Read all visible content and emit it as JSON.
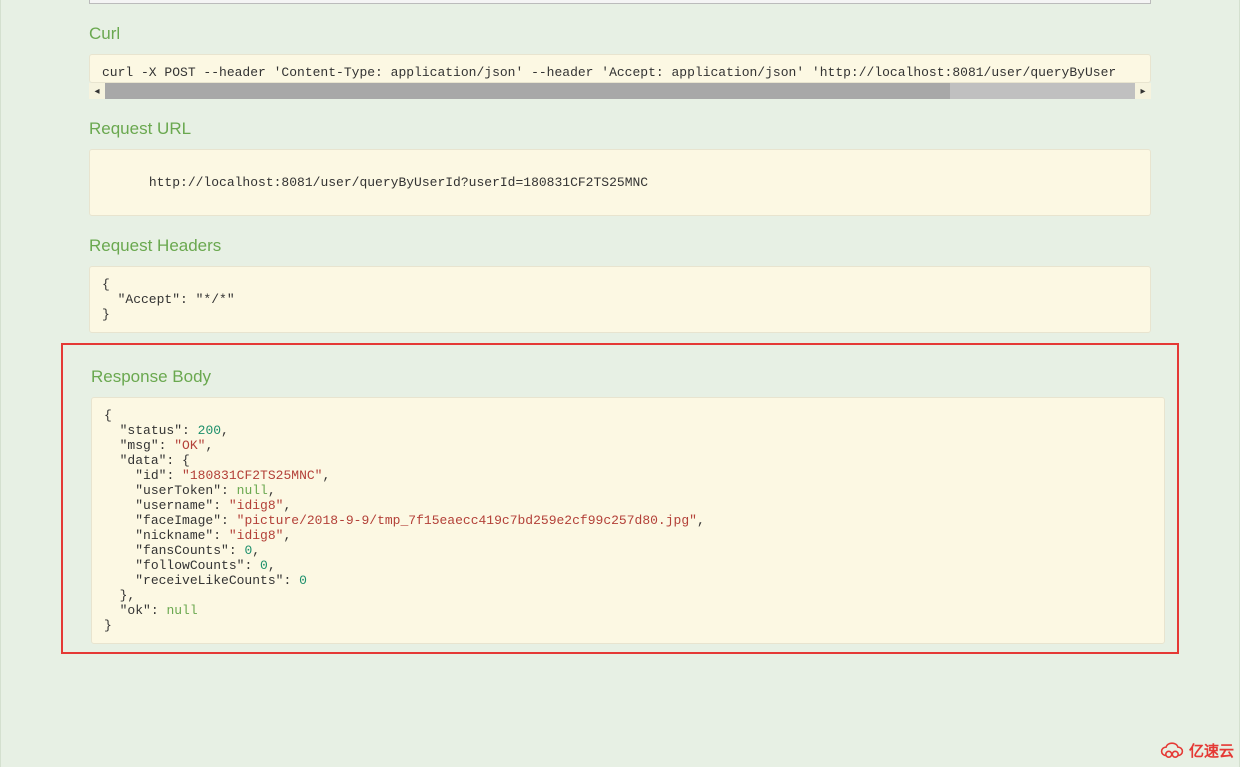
{
  "sections": {
    "curl": {
      "title": "Curl",
      "command": "curl -X POST --header 'Content-Type: application/json' --header 'Accept: application/json' 'http://localhost:8081/user/queryByUser"
    },
    "request_url": {
      "title": "Request URL",
      "value": "http://localhost:8081/user/queryByUserId?userId=180831CF2TS25MNC"
    },
    "request_headers": {
      "title": "Request Headers",
      "value": "{\n  \"Accept\": \"*/*\"\n}"
    },
    "response_body": {
      "title": "Response Body",
      "data": {
        "status": 200,
        "msg": "OK",
        "data": {
          "id": "180831CF2TS25MNC",
          "userToken": null,
          "username": "idig8",
          "faceImage": "picture/2018-9-9/tmp_7f15eaecc419c7bd259e2cf99c257d80.jpg",
          "nickname": "idig8",
          "fansCounts": 0,
          "followCounts": 0,
          "receiveLikeCounts": 0
        },
        "ok": null
      }
    }
  },
  "watermark": "亿速云"
}
